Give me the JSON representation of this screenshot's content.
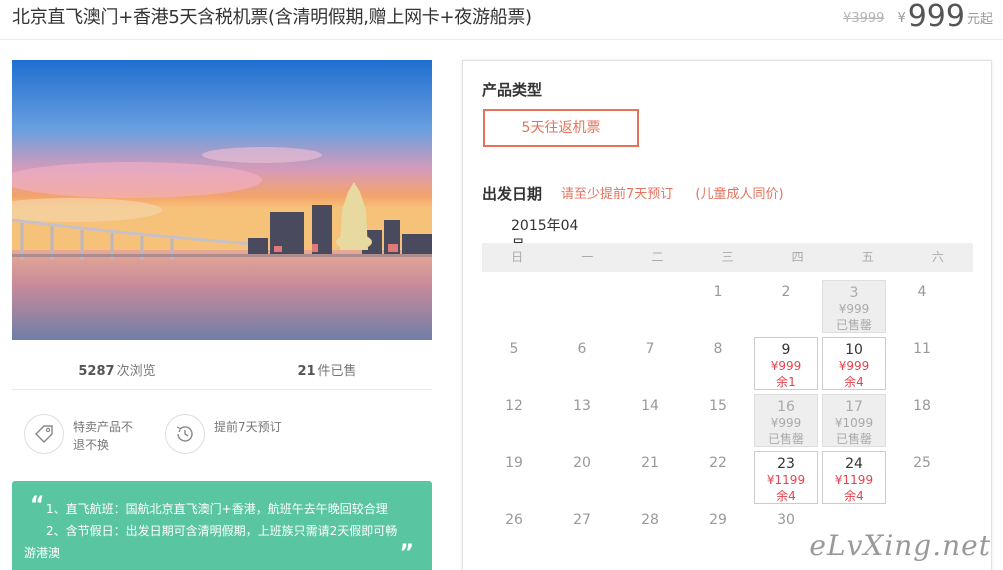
{
  "header": {
    "title": "北京直飞澳门+香港5天含税机票(含清明假期,赠上网卡+夜游船票)",
    "old_price": "¥3999",
    "currency": "¥",
    "price": "999",
    "price_unit": "元起"
  },
  "stats": {
    "views_count": "5287",
    "views_label": "次浏览",
    "sold_count": "21",
    "sold_label": "件已售"
  },
  "features": [
    {
      "icon": "tag-icon",
      "text": "特卖产品不退不换"
    },
    {
      "icon": "clock-history-icon",
      "text": "提前7天预订"
    }
  ],
  "notes": {
    "line1": "1、直飞航班：国航北京直飞澳门+香港，航班午去午晚回较合理",
    "line2": "2、含节假日：出发日期可含清明假期，上班族只需请2天假即可畅",
    "line3": "游港澳",
    "open_quote": "“",
    "close_quote": "”"
  },
  "booking": {
    "product_type_label": "产品类型",
    "product_type_option": "5天往返机票",
    "depart_label": "出发日期",
    "hint1": "请至少提前7天预订",
    "hint2": "(儿童成人同价)",
    "month": "2015年04月",
    "weekdays": [
      "日",
      "一",
      "二",
      "三",
      "四",
      "五",
      "六"
    ],
    "calendar": [
      [
        {
          "d": ""
        },
        {
          "d": ""
        },
        {
          "d": ""
        },
        {
          "d": "1"
        },
        {
          "d": "2"
        },
        {
          "d": "3",
          "p": "¥999",
          "s": "已售罄",
          "st": "sold"
        },
        {
          "d": "4"
        }
      ],
      [
        {
          "d": "5"
        },
        {
          "d": "6"
        },
        {
          "d": "7"
        },
        {
          "d": "8"
        },
        {
          "d": "9",
          "p": "¥999",
          "s": "余1",
          "st": "avail"
        },
        {
          "d": "10",
          "p": "¥999",
          "s": "余4",
          "st": "avail"
        },
        {
          "d": "11"
        }
      ],
      [
        {
          "d": "12"
        },
        {
          "d": "13"
        },
        {
          "d": "14"
        },
        {
          "d": "15"
        },
        {
          "d": "16",
          "p": "¥999",
          "s": "已售罄",
          "st": "sold"
        },
        {
          "d": "17",
          "p": "¥1099",
          "s": "已售罄",
          "st": "sold"
        },
        {
          "d": "18"
        }
      ],
      [
        {
          "d": "19"
        },
        {
          "d": "20"
        },
        {
          "d": "21"
        },
        {
          "d": "22"
        },
        {
          "d": "23",
          "p": "¥1199",
          "s": "余4",
          "st": "avail"
        },
        {
          "d": "24",
          "p": "¥1199",
          "s": "余4",
          "st": "avail"
        },
        {
          "d": "25"
        }
      ],
      [
        {
          "d": "26"
        },
        {
          "d": "27"
        },
        {
          "d": "28"
        },
        {
          "d": "29"
        },
        {
          "d": "30"
        },
        {
          "d": ""
        },
        {
          "d": ""
        }
      ]
    ]
  },
  "watermark": "eLvXing.net",
  "colors": {
    "accent": "#e6725c",
    "notes_bg": "#5ac6a1",
    "price_red": "#e6434f"
  }
}
